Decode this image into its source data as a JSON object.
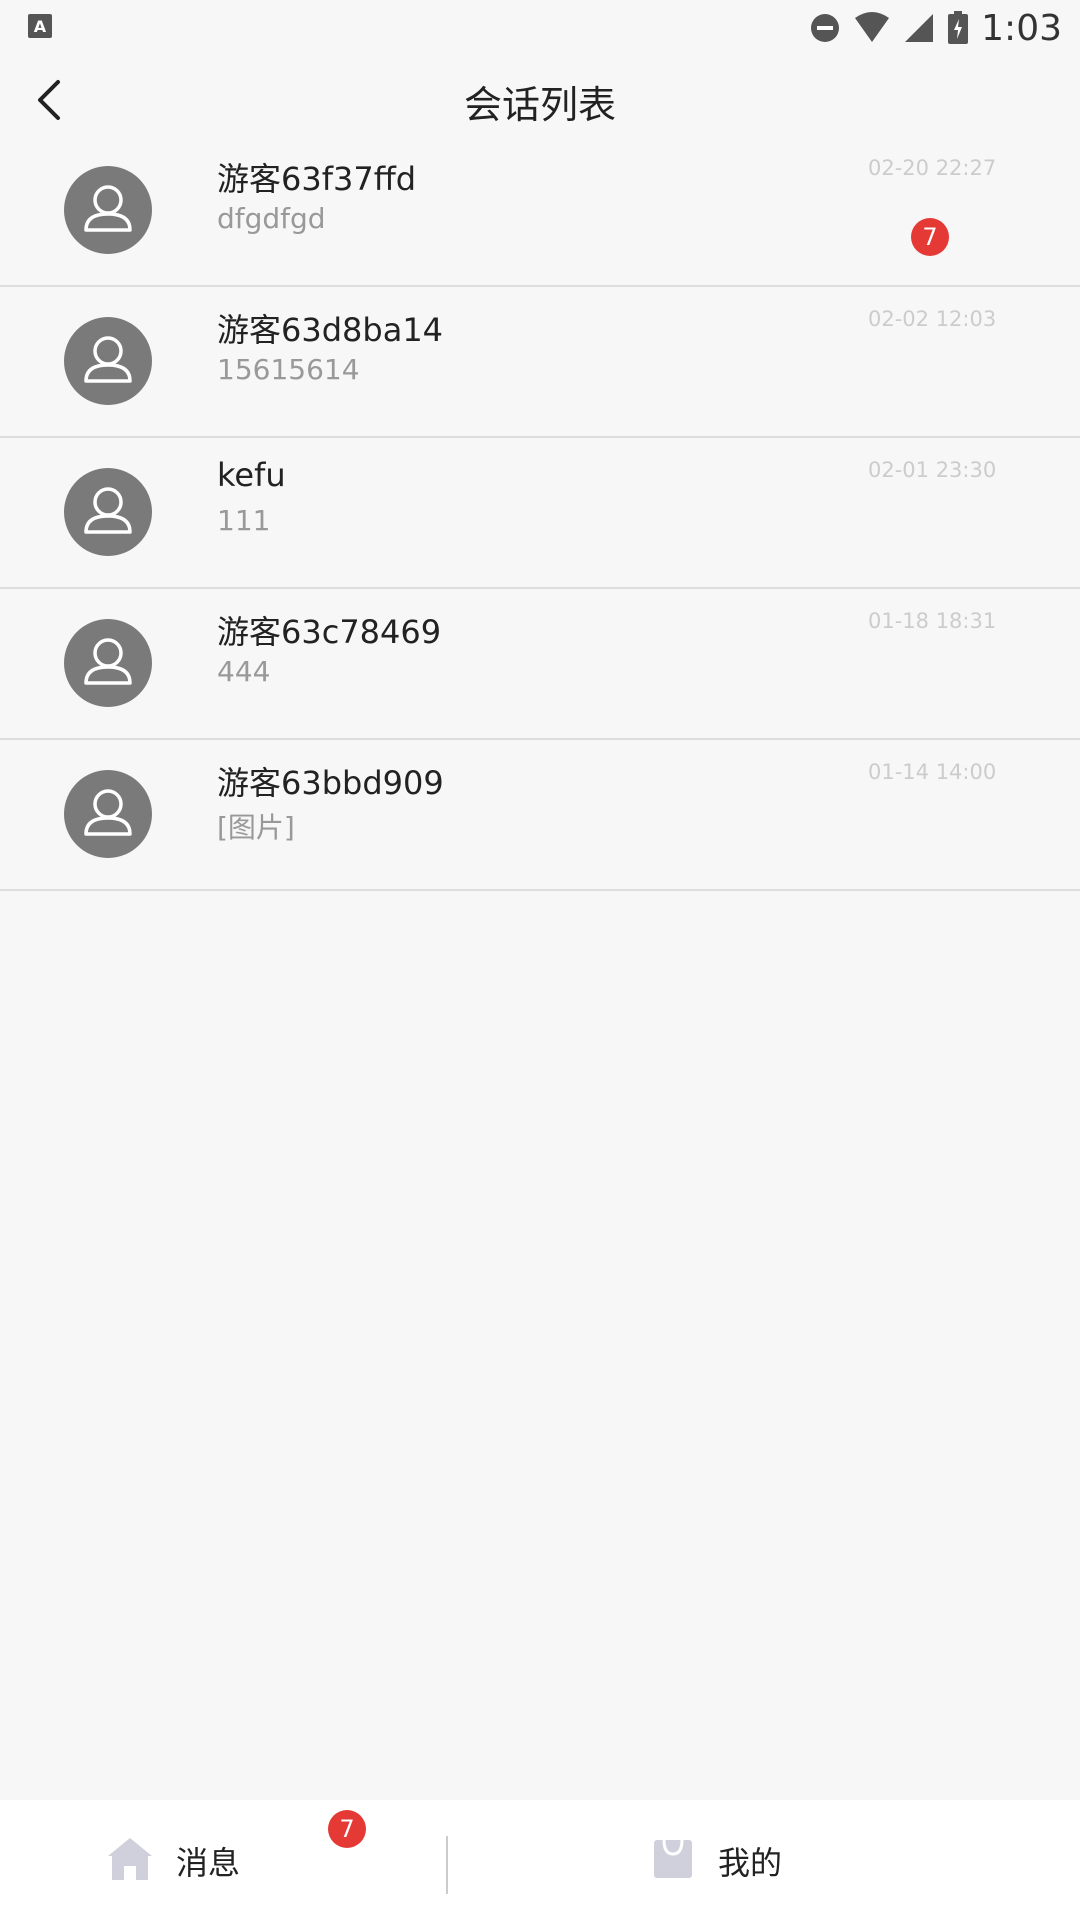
{
  "status_bar": {
    "app_icon_letter": "A",
    "time": "1:03",
    "icons": [
      "do-not-disturb-icon",
      "wifi-icon",
      "signal-icon",
      "battery-charging-icon"
    ]
  },
  "header": {
    "title": "会话列表",
    "back_icon": "chevron-left-icon"
  },
  "conversations": [
    {
      "name": "游客63f37ffd",
      "message": "dfgdfgd",
      "time": "02-20 22:27",
      "badge": "7"
    },
    {
      "name": "游客63d8ba14",
      "message": "15615614",
      "time": "02-02 12:03"
    },
    {
      "name": "kefu",
      "message": "111",
      "time": "02-01 23:30"
    },
    {
      "name": "游客63c78469",
      "message": "444",
      "time": "01-18 18:31"
    },
    {
      "name": "游客63bbd909",
      "message": "[图片]",
      "time": "01-14 14:00"
    }
  ],
  "bottom_nav": {
    "messages_label": "消息",
    "messages_badge": "7",
    "mine_label": "我的"
  },
  "colors": {
    "background": "#f7f7f7",
    "avatar": "#7a7a7a",
    "badge": "#e53935",
    "divider": "#dddddd"
  }
}
